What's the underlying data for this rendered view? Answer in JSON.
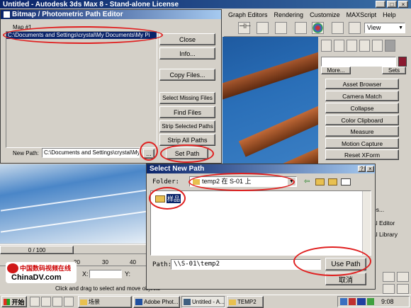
{
  "app": {
    "title": "Untitled - Autodesk 3ds Max 8 - Stand-alone License",
    "menus": [
      "Graph Editors",
      "Rendering",
      "Customize",
      "MAXScript",
      "Help"
    ],
    "view_dropdown": "View",
    "right_tabs": [
      "More...",
      "Sets"
    ],
    "utilities": [
      "Asset Browser",
      "Camera Match",
      "Collapse",
      "Color Clipboard",
      "Measure",
      "Motion Capture",
      "Reset XForm"
    ],
    "partial_right": [
      "al Editor",
      "al Library",
      "es..."
    ],
    "time_slider": "0 / 100",
    "ruler": [
      "20",
      "30",
      "40"
    ],
    "coords": [
      "X:",
      "Y:"
    ],
    "status": "Click and drag to select and move objects",
    "logo_cn": "中国数码视频在线",
    "logo_en": "ChinaDV.com"
  },
  "path_editor": {
    "title": "Bitmap / Photometric Path Editor",
    "map_label": "Map #1",
    "list_item": "C:\\Documents and Settings\\crystal\\My Documents\\My Pi",
    "buttons": {
      "close": "Close",
      "info": "Info...",
      "copy": "Copy Files...",
      "select_missing": "Select Missing Files",
      "find": "Find Files",
      "strip_selected": "Strip Selected Paths",
      "strip_all": "Strip All Paths",
      "set_path": "Set Path"
    },
    "new_path_label": "New Path:",
    "new_path_value": "C:\\Documents and Settings\\crystal\\My",
    "browse": "..."
  },
  "select_path": {
    "title": "Select New Path",
    "folder_label": "Folder:",
    "folder_value": "temp2 在 S-01 上",
    "item": "样品",
    "path_label": "Path:",
    "path_value": "\\\\S-01\\temp2",
    "use_path": "Use Path",
    "cancel": "取消"
  },
  "taskbar": {
    "start": "开始",
    "items": [
      "场景",
      "Adobe Phot...",
      "Untitled - A...",
      "TEMP2"
    ],
    "clock": "9:08"
  }
}
